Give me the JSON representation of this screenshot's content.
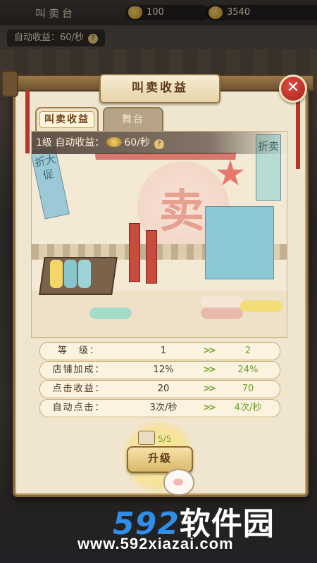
{
  "topbar": {
    "title": "叫卖台",
    "ingot_count": "100",
    "coin_count": "3540"
  },
  "auto_income_top": "自动收益：60/秒",
  "panel": {
    "title": "叫卖收益",
    "close_symbol": "✕",
    "tabs": [
      {
        "label": "叫卖收益",
        "active": true
      },
      {
        "label": "舞台",
        "active": false
      }
    ],
    "level_line": {
      "prefix": "1级  自动收益：",
      "rate": "60/秒",
      "help": "?"
    },
    "scene_text": {
      "sign_char": "卖",
      "banner_left": "折大促",
      "banner_right": "折卖"
    },
    "stats": [
      {
        "label": "等　级：",
        "current": "1",
        "arrow": ">>",
        "next": "2"
      },
      {
        "label": "店铺加成：",
        "current": "12%",
        "arrow": ">>",
        "next": "24%"
      },
      {
        "label": "点击收益：",
        "current": "20",
        "arrow": ">>",
        "next": "70"
      },
      {
        "label": "自动点击：",
        "current": "3次/秒",
        "arrow": ">>",
        "next": "4次/秒"
      }
    ],
    "upgrade": {
      "cost": "5/5",
      "button_label": "升级"
    }
  },
  "watermark": {
    "logo_num": "592",
    "logo_text": "软件园",
    "url": "www.592xiazai.com"
  },
  "colors": {
    "panel_bg": "#f0e6cf",
    "accent_green": "#6a9e2b",
    "close_red": "#d23a30"
  }
}
